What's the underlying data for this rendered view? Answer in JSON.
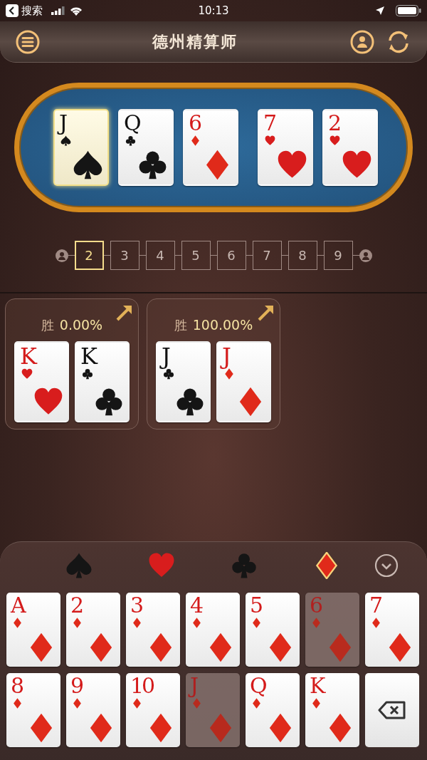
{
  "status_bar": {
    "back_label": "搜索",
    "time": "10:13"
  },
  "header": {
    "title": "德州精算师"
  },
  "board": {
    "cards": [
      {
        "rank": "J",
        "kind": "spade",
        "selected": true
      },
      {
        "rank": "Q",
        "kind": "club",
        "selected": false
      },
      {
        "rank": "6",
        "kind": "diamond",
        "selected": false
      },
      {
        "rank": "7",
        "kind": "heart",
        "selected": false
      },
      {
        "rank": "2",
        "kind": "heart",
        "selected": false
      }
    ]
  },
  "player_count": [
    {
      "label": "2",
      "selected": true
    },
    {
      "label": "3",
      "selected": false
    },
    {
      "label": "4",
      "selected": false
    },
    {
      "label": "5",
      "selected": false
    },
    {
      "label": "6",
      "selected": false
    },
    {
      "label": "7",
      "selected": false
    },
    {
      "label": "8",
      "selected": false
    },
    {
      "label": "9",
      "selected": false
    }
  ],
  "hands": [
    {
      "win_label": "胜",
      "win_rate": "0.00%",
      "cards": [
        {
          "rank": "K",
          "kind": "heart"
        },
        {
          "rank": "K",
          "kind": "club"
        }
      ]
    },
    {
      "win_label": "胜",
      "win_rate": "100.00%",
      "cards": [
        {
          "rank": "J",
          "kind": "club"
        },
        {
          "rank": "J",
          "kind": "diamond"
        }
      ]
    }
  ],
  "suit_tabs": [
    {
      "kind": "spade",
      "selected": false
    },
    {
      "kind": "heart",
      "selected": false
    },
    {
      "kind": "club",
      "selected": false
    },
    {
      "kind": "diamond",
      "selected": true
    }
  ],
  "keypad": [
    {
      "kind": "diamond",
      "rank": "A",
      "used": false
    },
    {
      "kind": "diamond",
      "rank": "2",
      "used": false
    },
    {
      "kind": "diamond",
      "rank": "3",
      "used": false
    },
    {
      "kind": "diamond",
      "rank": "4",
      "used": false
    },
    {
      "kind": "diamond",
      "rank": "5",
      "used": false
    },
    {
      "kind": "diamond",
      "rank": "6",
      "used": true
    },
    {
      "kind": "diamond",
      "rank": "7",
      "used": false
    },
    {
      "kind": "diamond",
      "rank": "8",
      "used": false
    },
    {
      "kind": "diamond",
      "rank": "9",
      "used": false
    },
    {
      "kind": "diamond",
      "rank": "10",
      "used": false
    },
    {
      "kind": "diamond",
      "rank": "J",
      "used": true
    },
    {
      "kind": "diamond",
      "rank": "Q",
      "used": false
    },
    {
      "kind": "diamond",
      "rank": "K",
      "used": false
    },
    {
      "kind": "delete"
    }
  ]
}
